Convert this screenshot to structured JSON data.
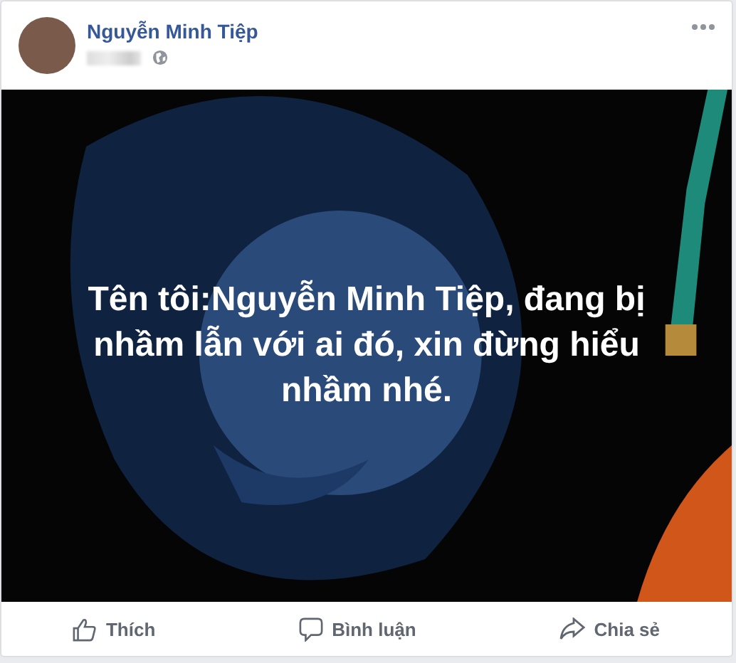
{
  "post": {
    "author": "Nguyễn Minh Tiệp",
    "text": "Tên tôi:Nguyễn Minh Tiệp, đang bị nhầm lẫn với ai đó, xin đừng hiểu nhầm nhé."
  },
  "actions": [
    {
      "kind": "like",
      "label": "Thích"
    },
    {
      "kind": "comment",
      "label": "Bình luận"
    },
    {
      "kind": "share",
      "label": "Chia sẻ"
    }
  ]
}
